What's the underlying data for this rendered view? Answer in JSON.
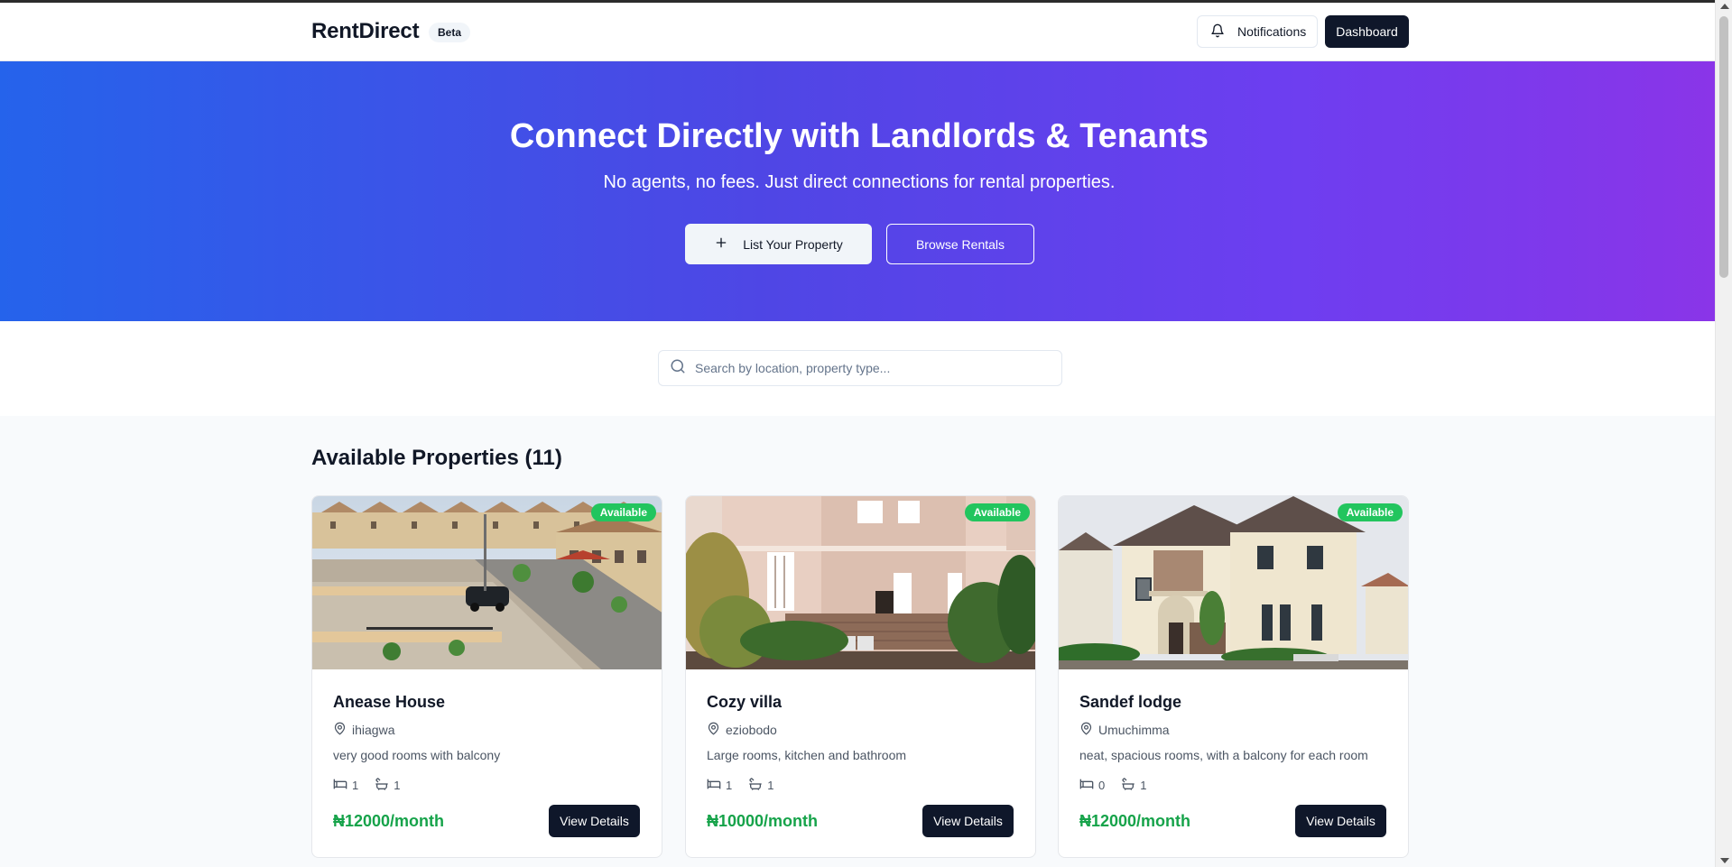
{
  "header": {
    "brand": "RentDirect",
    "badge": "Beta",
    "notifications_label": "Notifications",
    "dashboard_label": "Dashboard"
  },
  "hero": {
    "title": "Connect Directly with Landlords & Tenants",
    "subtitle": "No agents, no fees. Just direct connections for rental properties.",
    "list_button": "List Your Property",
    "browse_button": "Browse Rentals"
  },
  "search": {
    "placeholder": "Search by location, property type..."
  },
  "properties": {
    "title": "Available Properties (11)",
    "items": [
      {
        "status": "Available",
        "name": "Anease House",
        "location": "ihiagwa",
        "description": "very good rooms with balcony",
        "beds": "1",
        "baths": "1",
        "price": "₦12000/month",
        "button": "View Details"
      },
      {
        "status": "Available",
        "name": "Cozy villa",
        "location": "eziobodo",
        "description": "Large rooms, kitchen and bathroom",
        "beds": "1",
        "baths": "1",
        "price": "₦10000/month",
        "button": "View Details"
      },
      {
        "status": "Available",
        "name": "Sandef lodge",
        "location": "Umuchimma",
        "description": "neat, spacious rooms, with a balcony for each room",
        "beds": "0",
        "baths": "1",
        "price": "₦12000/month",
        "button": "View Details"
      }
    ]
  },
  "colors": {
    "hero_gradient_start": "#2563eb",
    "hero_gradient_end": "#8a35e8",
    "primary_dark": "#0f172a",
    "available_badge": "#22c55e",
    "price_green": "#16a34a"
  },
  "icons": [
    "bell-icon",
    "plus-icon",
    "search-icon",
    "map-pin-icon",
    "bed-icon",
    "bath-icon"
  ]
}
